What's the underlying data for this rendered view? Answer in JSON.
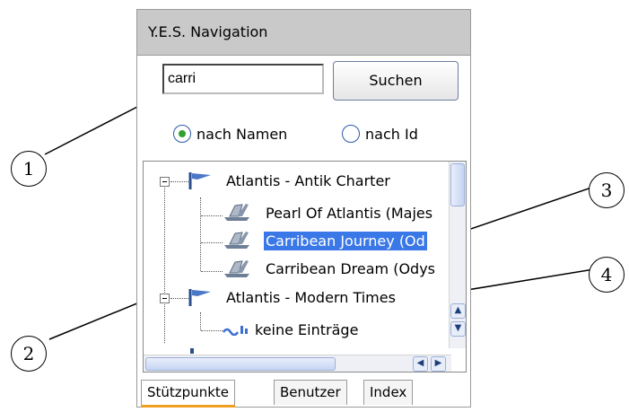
{
  "panel": {
    "title": "Y.E.S. Navigation",
    "search": {
      "value": "carri",
      "button_label": "Suchen"
    },
    "radio_options": [
      {
        "label": "nach Namen",
        "selected": true
      },
      {
        "label": "nach Id",
        "selected": false
      }
    ],
    "tree": [
      {
        "label": "Atlantis - Antik Charter",
        "icon": "flag-icon",
        "level": 0
      },
      {
        "label": "Pearl Of Atlantis (Majes",
        "icon": "ship-icon",
        "level": 1
      },
      {
        "label": "Carribean Journey (Od",
        "icon": "ship-icon",
        "level": 1,
        "selected": true
      },
      {
        "label": "Carribean Dream (Odys",
        "icon": "ship-icon",
        "level": 1
      },
      {
        "label": "Atlantis - Modern Times",
        "icon": "flag-icon",
        "level": 0
      },
      {
        "label": "keine Einträge",
        "icon": "wave-icon",
        "level": 1
      }
    ],
    "tabs": [
      {
        "label": "Stützpunkte",
        "active": true
      },
      {
        "label": "Benutzer",
        "active": false
      },
      {
        "label": "Index",
        "active": false
      }
    ]
  },
  "callouts": [
    "1",
    "2",
    "3",
    "4"
  ],
  "colors": {
    "selection": "#3b78e7",
    "radio_dot": "#2fa22f",
    "tab_indicator": "#f0a020",
    "header": "#c9c9c9"
  }
}
